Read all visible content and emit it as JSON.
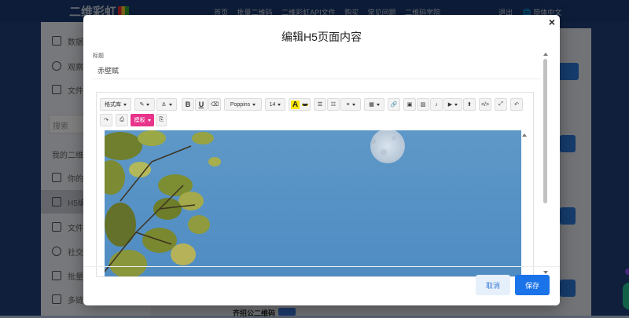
{
  "app": {
    "logo": "二维彩虹",
    "nav": [
      "首页",
      "批量二维码",
      "二维彩虹API文件",
      "购买",
      "常见问题",
      "二维码学院"
    ],
    "logout": "退出",
    "language": "简体中文"
  },
  "sidebar": {
    "items": [
      "数据",
      "观察",
      "文件"
    ],
    "search_placeholder": "搜索",
    "section": "我的二维",
    "sub_items": [
      "你的",
      "H5编",
      "文件",
      "社交",
      "批量",
      "多链"
    ]
  },
  "background": {
    "bottom_title": "齐招公二维码"
  },
  "modal": {
    "title": "编辑H5页面内容",
    "close": "×",
    "field_label": "标题",
    "field_value": "赤壁赋",
    "toolbar": {
      "styles": "格式库",
      "font": "Poppins",
      "size": "14",
      "template": "模板"
    },
    "cancel": "取消",
    "save": "保存"
  },
  "colors": {
    "primary": "#1a73e8",
    "accent_pink": "#e8348a",
    "header_bg": "#1b3a73"
  }
}
